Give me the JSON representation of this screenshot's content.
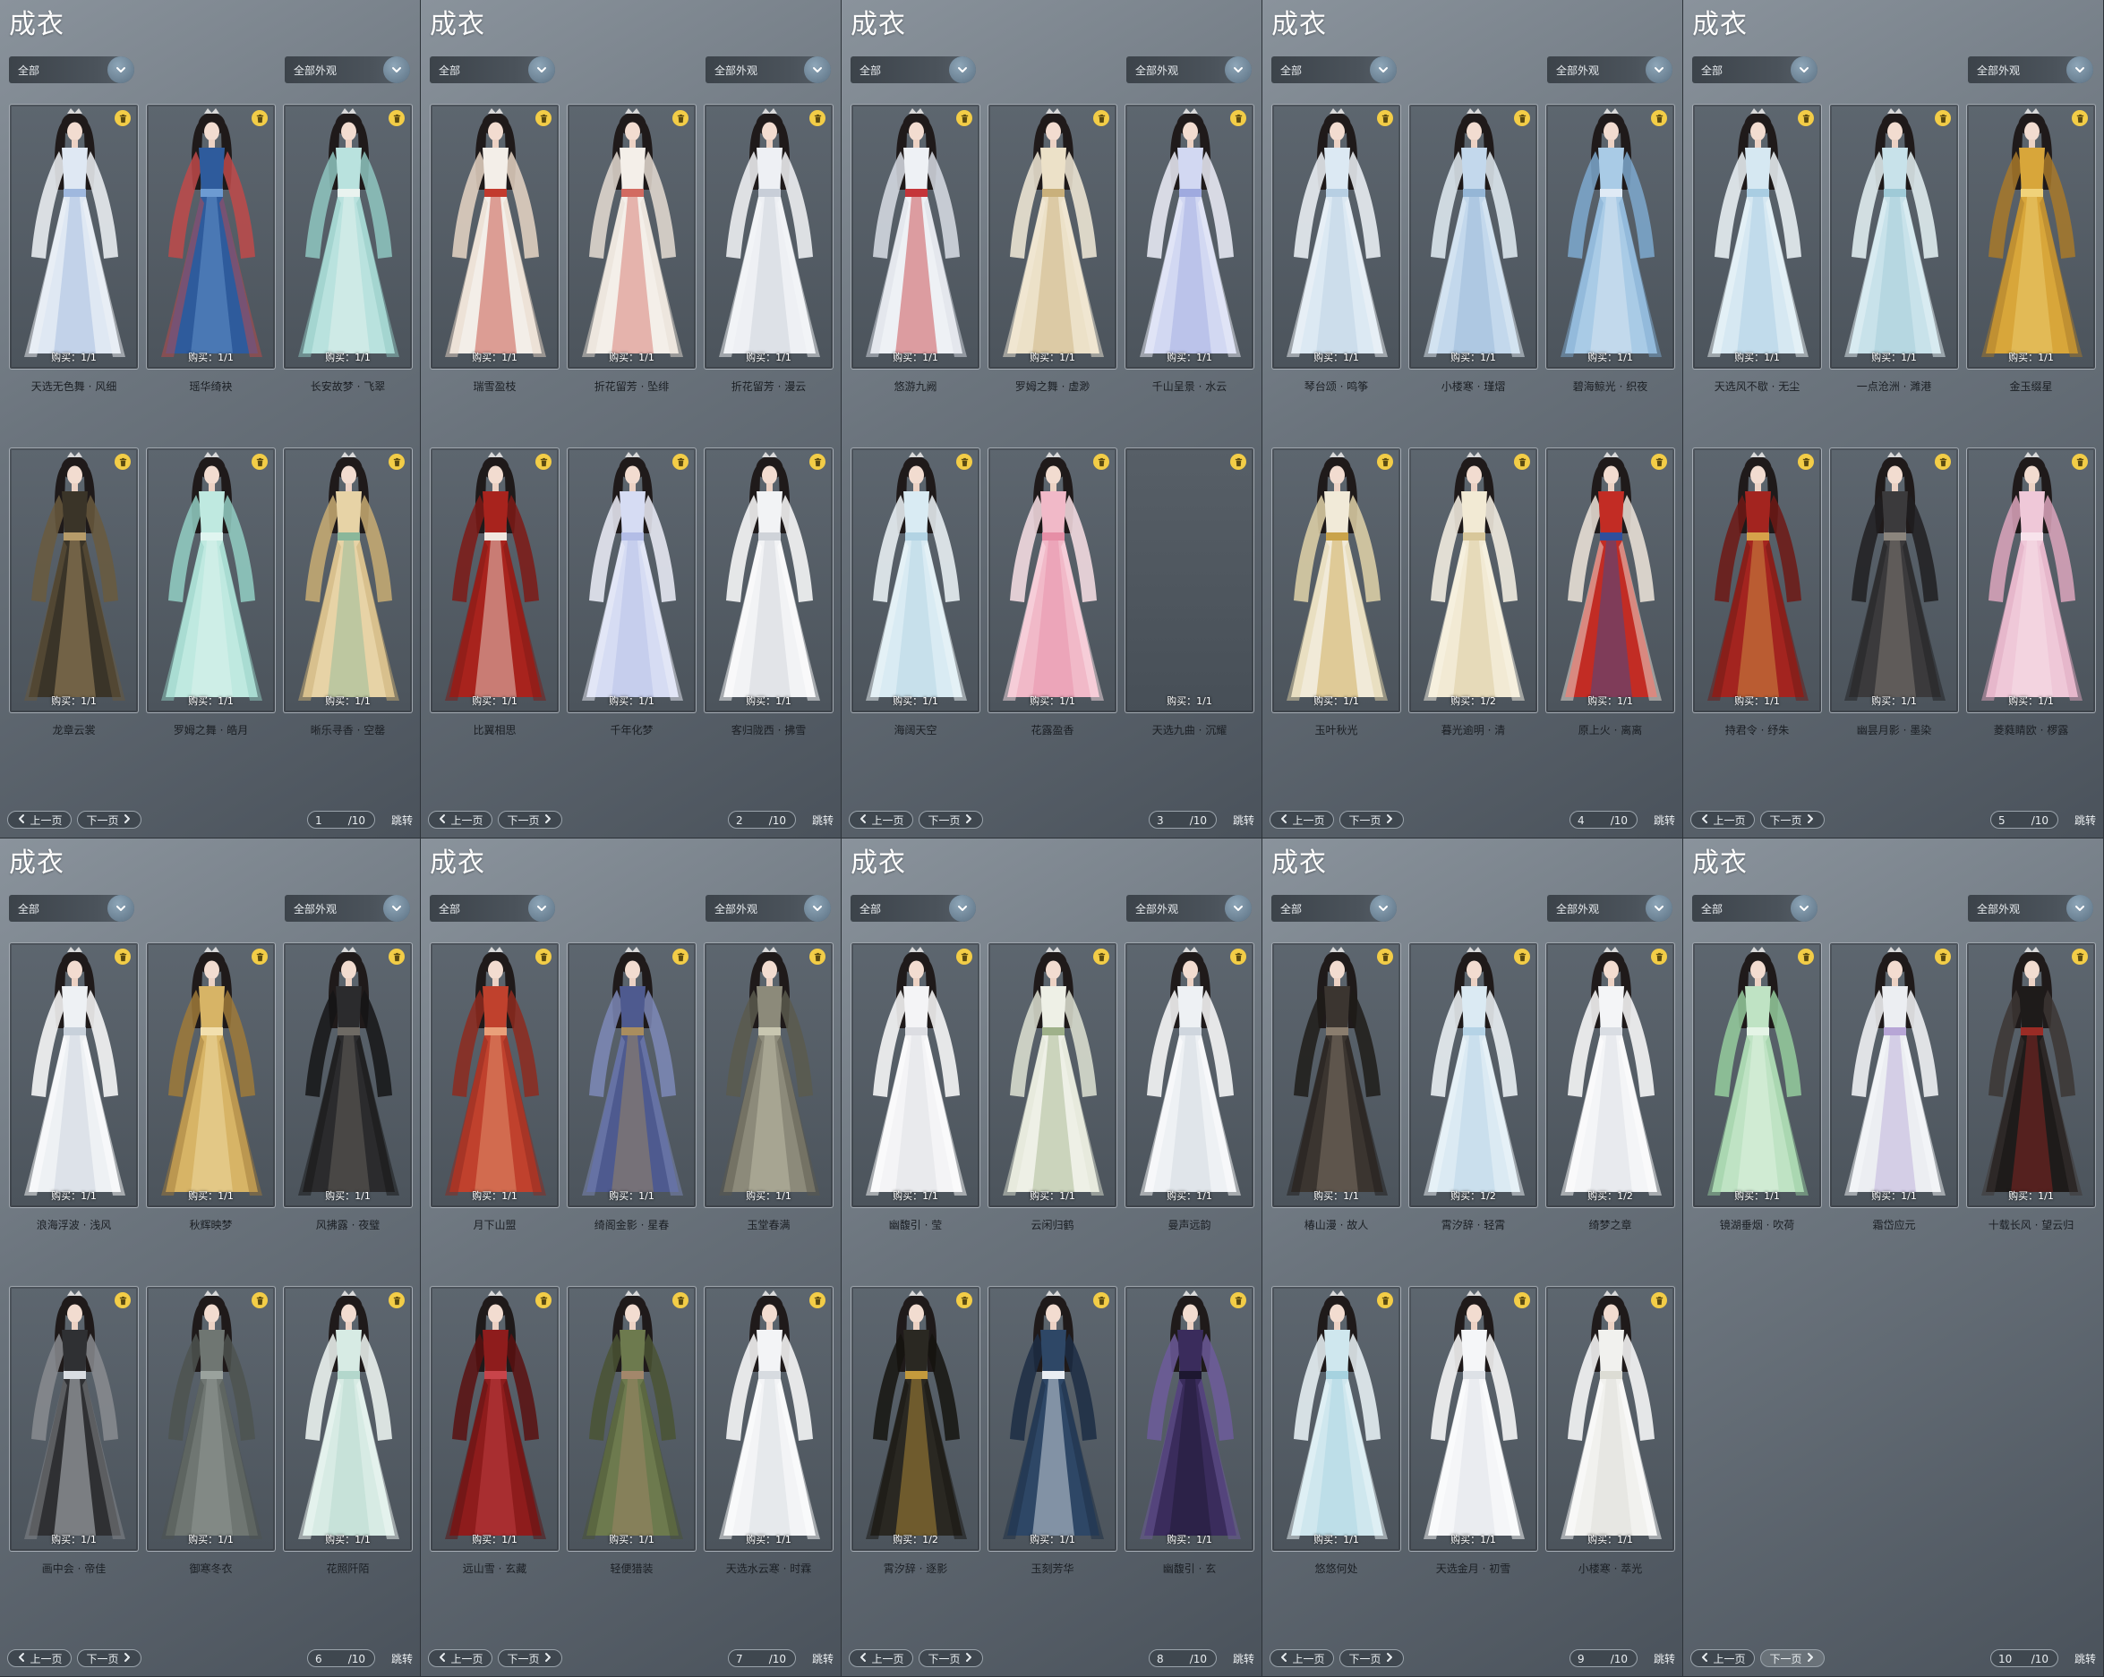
{
  "panel_title": "成衣",
  "filter_category": "全部",
  "filter_appearance": "全部外观",
  "prev_label": "上一页",
  "next_label": "下一页",
  "jump_label": "跳转",
  "total_pages": "/10",
  "colors": {
    "panel_top": "#8a939c",
    "panel_bottom": "#4a525b",
    "trash": "#f3cd47",
    "name_text": "#1b1f24"
  },
  "icons": {
    "trash": "trash-icon",
    "dropdown": "chevron-down-icon",
    "prev": "chevron-left-icon",
    "next": "chevron-right-icon"
  },
  "pages": [
    {
      "page": "1",
      "items": [
        {
          "name": "天选无色舞 · 风细",
          "buy": "购买：1/1",
          "palette": [
            "#dfe8f3",
            "#9fb8de",
            "#f1f4f8"
          ]
        },
        {
          "name": "瑶华绮袂",
          "buy": "购买：1/1",
          "palette": [
            "#2e5b9c",
            "#6d9bd2",
            "#c04a4a"
          ]
        },
        {
          "name": "长安故梦 · 飞翠",
          "buy": "购买：1/1",
          "palette": [
            "#b9e2de",
            "#e9f3ef",
            "#8fc7c1"
          ]
        },
        {
          "name": "龙章云裳",
          "buy": "购买：1/1",
          "palette": [
            "#3a3428",
            "#b79c6a",
            "#6a5a3e"
          ]
        },
        {
          "name": "罗姆之舞 · 皓月",
          "buy": "购买：1/1",
          "palette": [
            "#bfe9e0",
            "#e0f5f0",
            "#93cfc4"
          ]
        },
        {
          "name": "晰乐寻香 · 空罄",
          "buy": "购买：1/1",
          "palette": [
            "#e7d3a6",
            "#8ab79a",
            "#c9ad73"
          ]
        }
      ]
    },
    {
      "page": "2",
      "items": [
        {
          "name": "瑞雪盈枝",
          "buy": "购买：1/1",
          "palette": [
            "#f3eee8",
            "#c23a2e",
            "#e7d6c6"
          ]
        },
        {
          "name": "折花留芳 · 坠绯",
          "buy": "购买：1/1",
          "palette": [
            "#f4efe9",
            "#d26b61",
            "#e6ddd4"
          ]
        },
        {
          "name": "折花留芳 · 漫云",
          "buy": "购买：1/1",
          "palette": [
            "#eef0f4",
            "#c8ced8",
            "#f6f7f9"
          ]
        },
        {
          "name": "比翼相思",
          "buy": "购买：1/1",
          "palette": [
            "#a8231d",
            "#f1e8e0",
            "#7e1a16"
          ]
        },
        {
          "name": "千年化梦",
          "buy": "购买：1/1",
          "palette": [
            "#d6dcf3",
            "#b3bde6",
            "#eef0fa"
          ]
        },
        {
          "name": "客归陇西 · 拂雪",
          "buy": "购买：1/1",
          "palette": [
            "#f2f3f5",
            "#cfd3d9",
            "#ffffff"
          ]
        }
      ]
    },
    {
      "page": "3",
      "items": [
        {
          "name": "悠游九阙",
          "buy": "购买：1/1",
          "palette": [
            "#eef1f5",
            "#c5353a",
            "#d9dee6"
          ]
        },
        {
          "name": "罗姆之舞 · 虚渺",
          "buy": "购买：1/1",
          "palette": [
            "#ece1c8",
            "#c9b07b",
            "#f4ecd9"
          ]
        },
        {
          "name": "千山呈景 · 水云",
          "buy": "购买：1/1",
          "palette": [
            "#d2d8f2",
            "#9faadf",
            "#eef0fa"
          ]
        },
        {
          "name": "海阔天空",
          "buy": "购买：1/1",
          "palette": [
            "#d9ebf3",
            "#b2d3e3",
            "#f0f7fa"
          ]
        },
        {
          "name": "花露盈香",
          "buy": "购买：1/1",
          "palette": [
            "#f1b9c8",
            "#e68ea6",
            "#fbe2e8"
          ]
        },
        {
          "name": "天选九曲 · 沉耀",
          "buy": "购买：1/1",
          "palette": [],
          "empty": true
        }
      ]
    },
    {
      "page": "4",
      "items": [
        {
          "name": "琴台颂 · 鸣筝",
          "buy": "购买：1/1",
          "palette": [
            "#dce9f3",
            "#b7cfe3",
            "#f1f6fa"
          ]
        },
        {
          "name": "小楼寒 · 瑾熠",
          "buy": "购买：1/1",
          "palette": [
            "#c3d8ec",
            "#95b6d6",
            "#e4eef6"
          ]
        },
        {
          "name": "碧海鲸光 · 织夜",
          "buy": "购买：1/1",
          "palette": [
            "#a9cbe6",
            "#dfeaf5",
            "#7ea9cf"
          ]
        },
        {
          "name": "玉叶秋光",
          "buy": "购买：1/1",
          "palette": [
            "#f1ead8",
            "#c9a34a",
            "#e2d3a9"
          ]
        },
        {
          "name": "暮光逾明 · 清",
          "buy": "购买：1/2",
          "palette": [
            "#f2ead4",
            "#d8c79a",
            "#faf5e7"
          ]
        },
        {
          "name": "原上火 · 离离",
          "buy": "购买：1/1",
          "palette": [
            "#c22c24",
            "#2f4f9c",
            "#f0e6dc"
          ]
        }
      ]
    },
    {
      "page": "5",
      "items": [
        {
          "name": "天选风不歇 · 无尘",
          "buy": "购买：1/1",
          "palette": [
            "#d6e8f2",
            "#a9cde2",
            "#f0f7fa"
          ]
        },
        {
          "name": "一点沧洲 · 濉港",
          "buy": "购买：1/1",
          "palette": [
            "#c8e2ea",
            "#9fcad7",
            "#e8f4f7"
          ]
        },
        {
          "name": "金玉缀星",
          "buy": "购买：1/1",
          "palette": [
            "#d8a63a",
            "#f0d27a",
            "#a8792a"
          ]
        },
        {
          "name": "持君令 · 纾朱",
          "buy": "购买：1/1",
          "palette": [
            "#a3241f",
            "#d6a24a",
            "#6e1915"
          ]
        },
        {
          "name": "幽昙月影 · 墨染",
          "buy": "购买：1/1",
          "palette": [
            "#3b3a3c",
            "#8b857d",
            "#201f21"
          ]
        },
        {
          "name": "菱蕤睛欧 · 椤露",
          "buy": "购买：1/1",
          "palette": [
            "#efc8d8",
            "#f8e3ec",
            "#dda6bd"
          ]
        }
      ]
    },
    {
      "page": "6",
      "items": [
        {
          "name": "浪海浮波 · 浅风",
          "buy": "购买：1/1",
          "palette": [
            "#eef1f4",
            "#c8d1db",
            "#ffffff"
          ]
        },
        {
          "name": "秋辉映梦",
          "buy": "购买：1/1",
          "palette": [
            "#d7b466",
            "#f2dfae",
            "#9f7a3a"
          ]
        },
        {
          "name": "风拂露 · 夜璧",
          "buy": "购买：1/1",
          "palette": [
            "#2b2b2d",
            "#6e6a64",
            "#151516"
          ]
        },
        {
          "name": "画中会 · 帝佳",
          "buy": "购买：1/1",
          "palette": [
            "#2f3033",
            "#d9dde2",
            "#8a8c90"
          ]
        },
        {
          "name": "御寒冬衣",
          "buy": "购买：1/1",
          "palette": [
            "#6f7672",
            "#9aa29d",
            "#4d5350"
          ]
        },
        {
          "name": "花照阡陌",
          "buy": "购买：1/1",
          "palette": [
            "#d7ebe4",
            "#b3d7cc",
            "#f2f9f6"
          ]
        }
      ]
    },
    {
      "page": "7",
      "items": [
        {
          "name": "月下山盟",
          "buy": "购买：1/1",
          "palette": [
            "#c0412d",
            "#e9a07a",
            "#8e2a1f"
          ]
        },
        {
          "name": "绮阁金影 · 星春",
          "buy": "购买：1/1",
          "palette": [
            "#4e5a8f",
            "#a98d5e",
            "#7e8ab9"
          ]
        },
        {
          "name": "玉堂春满",
          "buy": "购买：1/1",
          "palette": [
            "#8c8a7a",
            "#c8c6b0",
            "#5b5a4e"
          ]
        },
        {
          "name": "远山雪 · 玄藏",
          "buy": "购买：1/1",
          "palette": [
            "#8e1c1c",
            "#c8444a",
            "#5a1111"
          ]
        },
        {
          "name": "轻便猎装",
          "buy": "购买：1/1",
          "palette": [
            "#6d7a4e",
            "#a3876b",
            "#4a5434"
          ]
        },
        {
          "name": "天选水云寒 · 时霖",
          "buy": "购买：1/1",
          "palette": [
            "#f3f4f6",
            "#d7dbe0",
            "#ffffff"
          ]
        }
      ]
    },
    {
      "page": "8",
      "items": [
        {
          "name": "幽馥引 · 莹",
          "buy": "购买：1/1",
          "palette": [
            "#f4f4f6",
            "#dcdde2",
            "#ffffff"
          ]
        },
        {
          "name": "云闲归鹤",
          "buy": "购买：1/1",
          "palette": [
            "#eef0e6",
            "#9fb18a",
            "#dfe3d3"
          ]
        },
        {
          "name": "曼声远韵",
          "buy": "购买：1/1",
          "palette": [
            "#eef1f4",
            "#cfd6de",
            "#ffffff"
          ]
        },
        {
          "name": "霄汐辞 · 逐影",
          "buy": "购买：1/2",
          "palette": [
            "#2a2822",
            "#c49a3c",
            "#15140f"
          ]
        },
        {
          "name": "玉刻芳华",
          "buy": "购买：1/1",
          "palette": [
            "#2e4766",
            "#e9edf2",
            "#1c2d44"
          ]
        },
        {
          "name": "幽馥引 · 玄",
          "buy": "购买：1/1",
          "palette": [
            "#3a2c5c",
            "#1d1730",
            "#6d5c9b"
          ]
        }
      ]
    },
    {
      "page": "9",
      "items": [
        {
          "name": "椿山漫 · 故人",
          "buy": "购买：1/1",
          "palette": [
            "#3b3530",
            "#8a7d6e",
            "#1f1c19"
          ]
        },
        {
          "name": "霄汐辞 · 轻霄",
          "buy": "购买：1/2",
          "palette": [
            "#dbeaf3",
            "#b5d3e6",
            "#f2f8fb"
          ]
        },
        {
          "name": "绮梦之章",
          "buy": "购买：1/2",
          "palette": [
            "#f4f5f7",
            "#d9dde3",
            "#ffffff"
          ]
        },
        {
          "name": "悠悠何处",
          "buy": "购买：1/1",
          "palette": [
            "#cfe7ee",
            "#a6d2df",
            "#edf7fa"
          ]
        },
        {
          "name": "天选金月 · 初雪",
          "buy": "购买：1/1",
          "palette": [
            "#f5f6f8",
            "#dde1e6",
            "#ffffff"
          ]
        },
        {
          "name": "小楼寒 · 萃光",
          "buy": "购买：1/1",
          "palette": [
            "#f1f1ee",
            "#dcdcd4",
            "#ffffff"
          ]
        }
      ]
    },
    {
      "page": "10",
      "items": [
        {
          "name": "镜湖垂烟 · 吹荷",
          "buy": "购买：1/1",
          "palette": [
            "#bfe3c4",
            "#e4f4e6",
            "#95cc9d"
          ]
        },
        {
          "name": "霜岱应元",
          "buy": "购买：1/1",
          "palette": [
            "#eceef2",
            "#b7a6d6",
            "#f8f9fb"
          ]
        },
        {
          "name": "十载长风 · 望云归",
          "buy": "购买：1/1",
          "palette": [
            "#1e1b1a",
            "#9a2b25",
            "#3c3634"
          ]
        }
      ]
    }
  ]
}
